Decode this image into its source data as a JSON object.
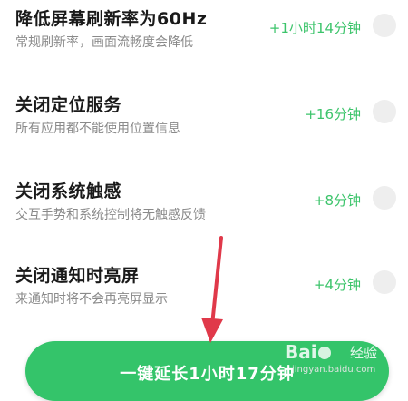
{
  "items": [
    {
      "title": "降低屏幕刷新率为60Hz",
      "subtitle": "常规刷新率，画面流畅度会降低",
      "gain": "+1小时14分钟",
      "check_icon": "circle-check-icon"
    },
    {
      "title": "关闭定位服务",
      "subtitle": "所有应用都不能使用位置信息",
      "gain": "+16分钟",
      "check_icon": "circle-check-icon"
    },
    {
      "title": "关闭系统触感",
      "subtitle": "交互手势和系统控制将无触感反馈",
      "gain": "+8分钟",
      "check_icon": "circle-check-icon"
    },
    {
      "title": "关闭通知时亮屏",
      "subtitle": "来通知时将不会再亮屏显示",
      "gain": "+4分钟",
      "check_icon": "circle-check-icon"
    }
  ],
  "cta": {
    "label": "一键延长1小时17分钟"
  },
  "watermark": {
    "logo_left": "Bai",
    "logo_right": "经验",
    "url": "jingyan.baidu.com"
  },
  "colors": {
    "accent_green": "#34c46a",
    "gain_green": "#3cc46b",
    "arrow_red": "#e0394a"
  }
}
